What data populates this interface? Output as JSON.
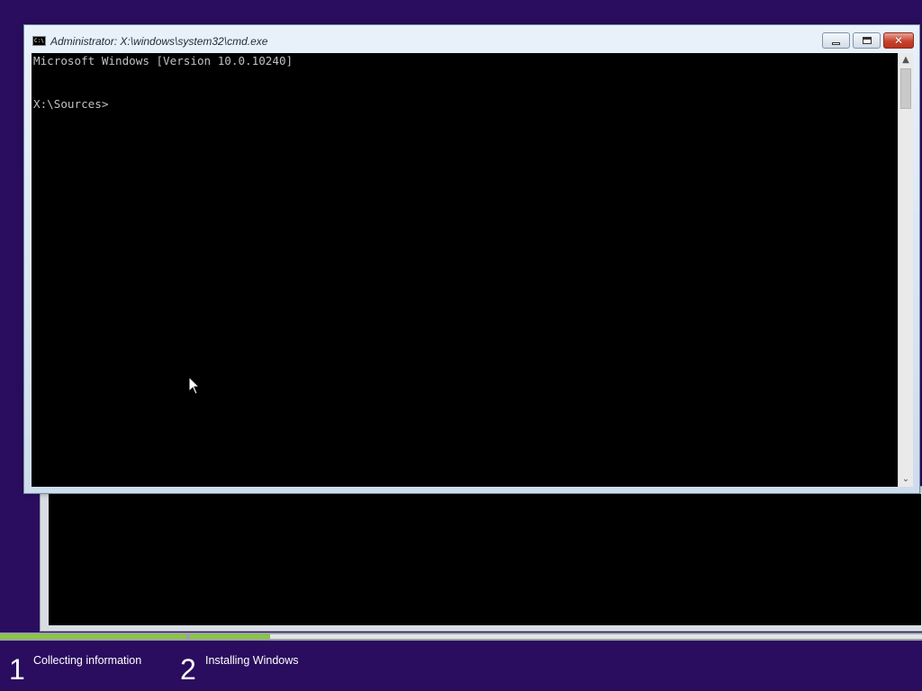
{
  "cmd_window": {
    "title": "Administrator: X:\\windows\\system32\\cmd.exe",
    "icon_name": "console-icon",
    "icon_text": "C:\\.",
    "controls": {
      "minimize_icon": "minimize-icon",
      "maximize_icon": "maximize-icon",
      "close_icon": "close-icon",
      "close_glyph": "✕"
    },
    "console_lines": [
      "Microsoft Windows [Version 10.0.10240]",
      "X:\\Sources>"
    ],
    "scrollbar": {
      "up_glyph": "▲",
      "down_glyph": "⌄"
    }
  },
  "background_window": {
    "down_glyph": "⌄"
  },
  "setup_progress": {
    "accent_color": "#8cc63f",
    "background_color": "#2a0d5e",
    "step_fill_fractions": [
      1.0,
      0.11
    ],
    "steps": [
      {
        "number": "1",
        "label": "Collecting information"
      },
      {
        "number": "2",
        "label": "Installing Windows"
      }
    ]
  }
}
